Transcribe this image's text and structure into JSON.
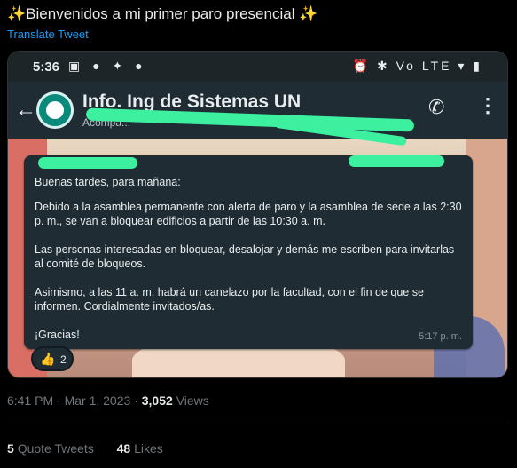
{
  "tweet": {
    "text": "✨Bienvenidos a mi primer paro presencial ✨",
    "translate_label": "Translate Tweet",
    "timestamp": "6:41 PM · Mar 1, 2023",
    "views_count": "3,052",
    "views_label": "Views",
    "quote_tweets_count": "5",
    "quote_tweets_label": "Quote Tweets",
    "likes_count": "48",
    "likes_label": "Likes"
  },
  "screenshot": {
    "status_bar": {
      "time": "5:36",
      "left_icons": "▣ ● ✦ ●",
      "right_icons": "⏰ ✱ Vo LTE ▾ ▮"
    },
    "chat": {
      "title": "Info. Ing de Sistemas UN",
      "subtitle": "Acompa..."
    },
    "message": {
      "line1": "Buenas tardes, para mañana:",
      "para1": "Debido a la asamblea permanente con alerta de paro y la asamblea de sede a las 2:30 p. m., se van a bloquear edificios a partir de las 10:30 a. m.",
      "para2": "Las personas interesadas en bloquear, desalojar y demás me escriben para invitarlas al comité de bloqueos.",
      "para3": "Asimismo, a las 11 a. m. habrá un canelazo por la facultad, con el fin de que se informen. Cordialmente invitados/as.",
      "closing": "¡Gracias!",
      "time": "5:17 p. m."
    },
    "reaction": {
      "emoji": "👍",
      "count": "2"
    }
  }
}
